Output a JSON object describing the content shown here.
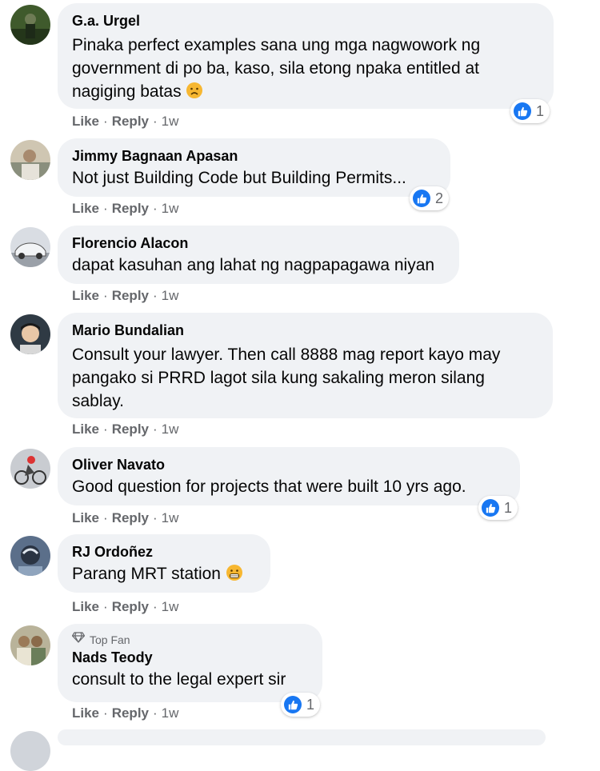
{
  "comments": [
    {
      "name": "G.a. Urgel",
      "lines": [
        "Pinaka perfect examples sana ung mga nagwowork ng",
        "government di po ba, kaso, sila etong npaka entitled at",
        "nagiging batas"
      ],
      "like": "Like",
      "reply": "Reply",
      "time": "1w",
      "reactions": "1",
      "emoji": "worried-face-icon"
    },
    {
      "name": "Jimmy Bagnaan Apasan",
      "lines": [
        "Not just Building Code but Building Permits..."
      ],
      "like": "Like",
      "reply": "Reply",
      "time": "1w",
      "reactions": "2"
    },
    {
      "name": "Florencio Alacon",
      "lines": [
        "dapat kasuhan ang lahat ng nagpapagawa niyan"
      ],
      "like": "Like",
      "reply": "Reply",
      "time": "1w"
    },
    {
      "name": "Mario Bundalian",
      "lines": [
        "Consult your lawyer. Then call 8888 mag report kayo may",
        "pangako si PRRD lagot sila kung sakaling meron silang",
        "sablay."
      ],
      "like": "Like",
      "reply": "Reply",
      "time": "1w"
    },
    {
      "name": "Oliver Navato",
      "lines": [
        "Good question for projects that were built 10 yrs ago."
      ],
      "like": "Like",
      "reply": "Reply",
      "time": "1w",
      "reactions": "1"
    },
    {
      "name": "RJ Ordoñez",
      "lines": [
        "Parang MRT station"
      ],
      "like": "Like",
      "reply": "Reply",
      "time": "1w",
      "emoji": "grimacing-face-icon"
    },
    {
      "badge": "Top Fan",
      "name": "Nads Teody",
      "lines": [
        "consult to the legal expert sir"
      ],
      "like": "Like",
      "reply": "Reply",
      "time": "1w",
      "reactions": "1"
    }
  ],
  "colors": {
    "bubble": "#f0f2f5",
    "meta": "#65676b",
    "like_blue": "#1877f2",
    "text": "#050505"
  }
}
